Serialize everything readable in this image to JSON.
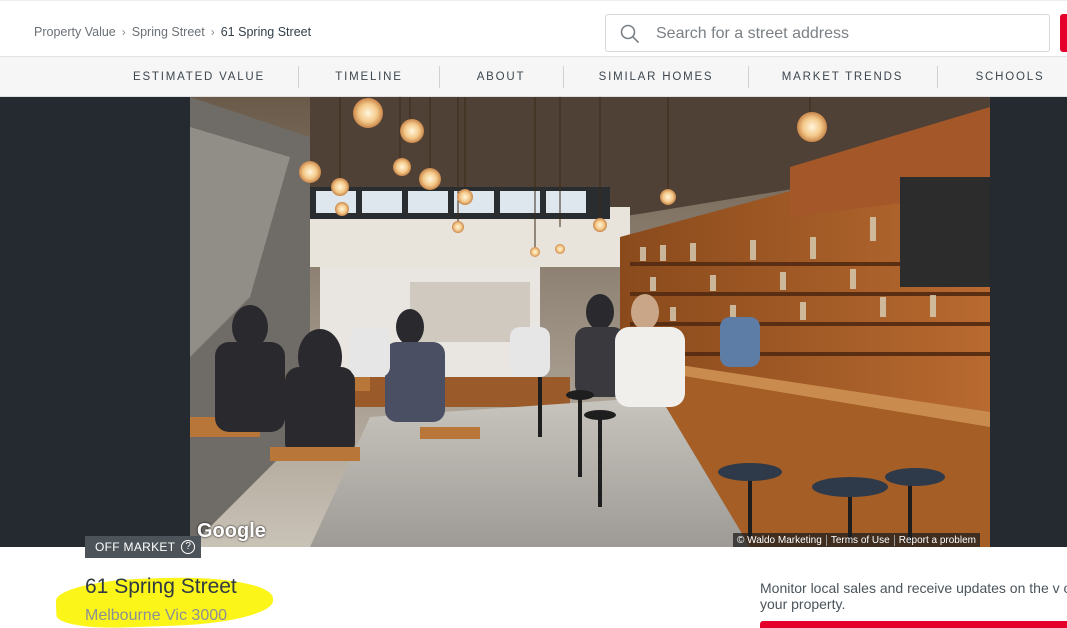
{
  "breadcrumb": {
    "items": [
      "Property Value",
      "Spring Street",
      "61 Spring Street"
    ]
  },
  "search": {
    "placeholder": "Search for a street address"
  },
  "tabs": [
    "ESTIMATED VALUE",
    "TIMELINE",
    "ABOUT",
    "SIMILAR HOMES",
    "MARKET TRENDS",
    "SCHOOLS"
  ],
  "map_view": {
    "provider": "Google",
    "attribution": [
      "© Waldo Marketing",
      "Terms of Use",
      "Report a problem"
    ],
    "compass_icon": "compass-icon"
  },
  "property": {
    "status": "OFF MARKET",
    "status_help_icon": "?",
    "address": "61 Spring Street",
    "suburb": "Melbourne Vic 3000"
  },
  "monitor": {
    "text": "Monitor local sales and receive updates on the v of your property."
  },
  "colors": {
    "accent": "#e4002b",
    "hero_bg": "#252a31",
    "highlight": "#fbf51a"
  }
}
